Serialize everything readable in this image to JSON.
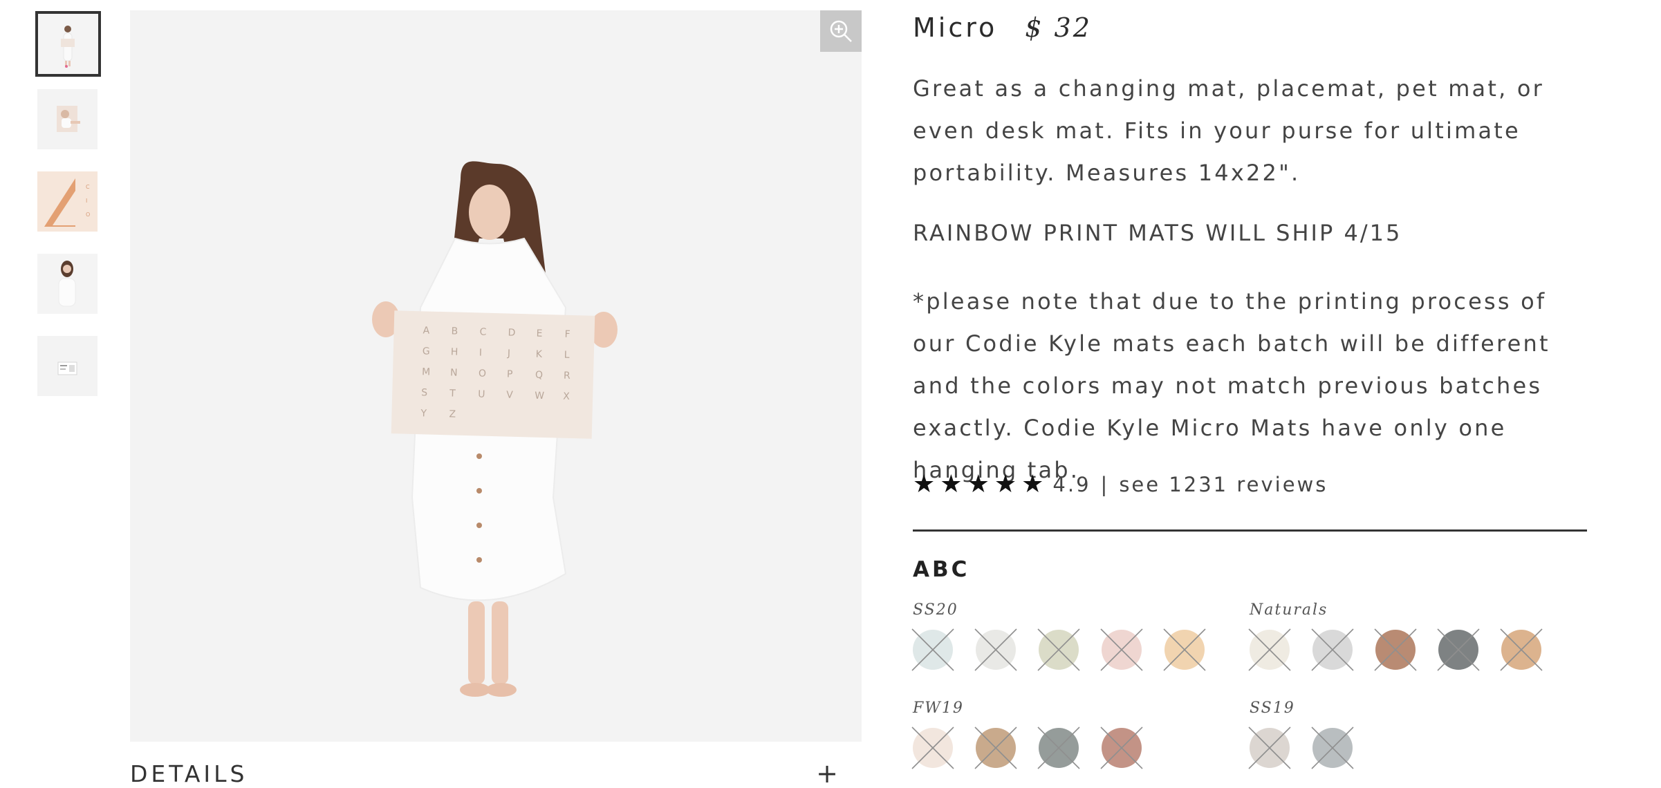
{
  "product": {
    "title": "Micro",
    "price": "$ 32",
    "description": "Great as a changing mat, placemat, pet mat, or even desk mat. Fits in your purse for ultimate portability. Measures 14x22\".",
    "ship_note": "RAINBOW PRINT MATS WILL SHIP 4/15",
    "note": "*please note that due to the printing process of our Codie Kyle mats each batch will be different and the colors may not match previous batches exactly. Codie Kyle Micro Mats have only one hanging tab.",
    "rating": {
      "stars": 5,
      "score": "4.9",
      "separator": "|",
      "reviews_text": "see 1231 reviews"
    }
  },
  "gallery": {
    "thumbnails": [
      "woman-holding-mat",
      "child-on-mat",
      "rainbow-print-mat",
      "woman-portrait",
      "mat-tag"
    ],
    "active_index": 0,
    "zoom_icon": "zoom-in-icon",
    "mat_letters": [
      "A",
      "B",
      "C",
      "D",
      "E",
      "F",
      "G",
      "H",
      "I",
      "J",
      "K",
      "L",
      "M",
      "N",
      "O",
      "P",
      "Q",
      "R",
      "S",
      "T",
      "U",
      "V",
      "W",
      "X",
      "Y",
      "Z"
    ]
  },
  "details": {
    "label": "DETAILS",
    "toggle": "+"
  },
  "options": {
    "section_title": "ABC",
    "groups": [
      {
        "label": "SS20",
        "colors": [
          "#dfe8e8",
          "#e9e9e6",
          "#dbdcc8",
          "#efd6d1",
          "#f1d4b0"
        ]
      },
      {
        "label": "Naturals",
        "colors": [
          "#efebe2",
          "#d9d9d9",
          "#b98b73",
          "#7e8283",
          "#dcb38e"
        ]
      },
      {
        "label": "FW19",
        "colors": [
          "#f2e6de",
          "#c9aa8c",
          "#959c9a",
          "#c39386"
        ]
      },
      {
        "label": "SS19",
        "colors": [
          "#dcd6d1",
          "#b9bec0"
        ]
      }
    ],
    "unavailable_mark_color": "#8f8f8f"
  }
}
